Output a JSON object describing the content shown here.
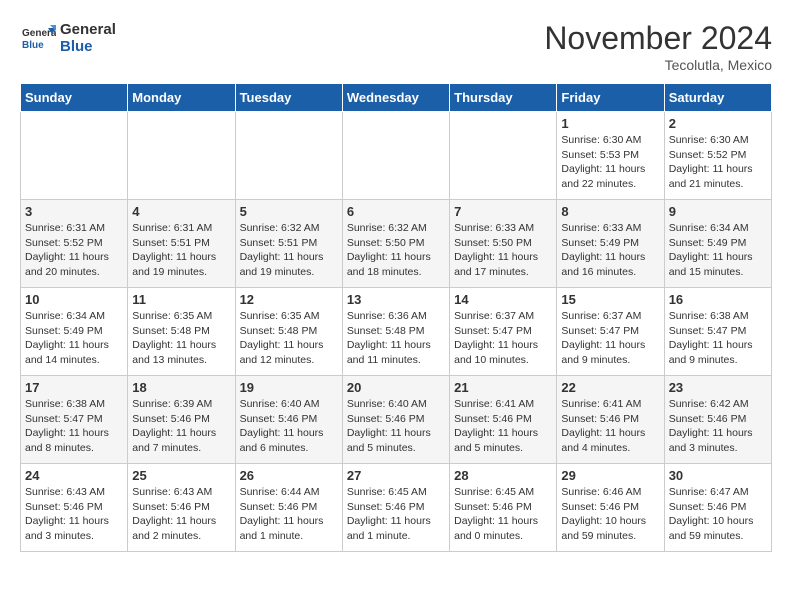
{
  "logo": {
    "line1": "General",
    "line2": "Blue"
  },
  "title": "November 2024",
  "location": "Tecolutla, Mexico",
  "days_of_week": [
    "Sunday",
    "Monday",
    "Tuesday",
    "Wednesday",
    "Thursday",
    "Friday",
    "Saturday"
  ],
  "weeks": [
    [
      {
        "day": "",
        "info": ""
      },
      {
        "day": "",
        "info": ""
      },
      {
        "day": "",
        "info": ""
      },
      {
        "day": "",
        "info": ""
      },
      {
        "day": "",
        "info": ""
      },
      {
        "day": "1",
        "info": "Sunrise: 6:30 AM\nSunset: 5:53 PM\nDaylight: 11 hours\nand 22 minutes."
      },
      {
        "day": "2",
        "info": "Sunrise: 6:30 AM\nSunset: 5:52 PM\nDaylight: 11 hours\nand 21 minutes."
      }
    ],
    [
      {
        "day": "3",
        "info": "Sunrise: 6:31 AM\nSunset: 5:52 PM\nDaylight: 11 hours\nand 20 minutes."
      },
      {
        "day": "4",
        "info": "Sunrise: 6:31 AM\nSunset: 5:51 PM\nDaylight: 11 hours\nand 19 minutes."
      },
      {
        "day": "5",
        "info": "Sunrise: 6:32 AM\nSunset: 5:51 PM\nDaylight: 11 hours\nand 19 minutes."
      },
      {
        "day": "6",
        "info": "Sunrise: 6:32 AM\nSunset: 5:50 PM\nDaylight: 11 hours\nand 18 minutes."
      },
      {
        "day": "7",
        "info": "Sunrise: 6:33 AM\nSunset: 5:50 PM\nDaylight: 11 hours\nand 17 minutes."
      },
      {
        "day": "8",
        "info": "Sunrise: 6:33 AM\nSunset: 5:49 PM\nDaylight: 11 hours\nand 16 minutes."
      },
      {
        "day": "9",
        "info": "Sunrise: 6:34 AM\nSunset: 5:49 PM\nDaylight: 11 hours\nand 15 minutes."
      }
    ],
    [
      {
        "day": "10",
        "info": "Sunrise: 6:34 AM\nSunset: 5:49 PM\nDaylight: 11 hours\nand 14 minutes."
      },
      {
        "day": "11",
        "info": "Sunrise: 6:35 AM\nSunset: 5:48 PM\nDaylight: 11 hours\nand 13 minutes."
      },
      {
        "day": "12",
        "info": "Sunrise: 6:35 AM\nSunset: 5:48 PM\nDaylight: 11 hours\nand 12 minutes."
      },
      {
        "day": "13",
        "info": "Sunrise: 6:36 AM\nSunset: 5:48 PM\nDaylight: 11 hours\nand 11 minutes."
      },
      {
        "day": "14",
        "info": "Sunrise: 6:37 AM\nSunset: 5:47 PM\nDaylight: 11 hours\nand 10 minutes."
      },
      {
        "day": "15",
        "info": "Sunrise: 6:37 AM\nSunset: 5:47 PM\nDaylight: 11 hours\nand 9 minutes."
      },
      {
        "day": "16",
        "info": "Sunrise: 6:38 AM\nSunset: 5:47 PM\nDaylight: 11 hours\nand 9 minutes."
      }
    ],
    [
      {
        "day": "17",
        "info": "Sunrise: 6:38 AM\nSunset: 5:47 PM\nDaylight: 11 hours\nand 8 minutes."
      },
      {
        "day": "18",
        "info": "Sunrise: 6:39 AM\nSunset: 5:46 PM\nDaylight: 11 hours\nand 7 minutes."
      },
      {
        "day": "19",
        "info": "Sunrise: 6:40 AM\nSunset: 5:46 PM\nDaylight: 11 hours\nand 6 minutes."
      },
      {
        "day": "20",
        "info": "Sunrise: 6:40 AM\nSunset: 5:46 PM\nDaylight: 11 hours\nand 5 minutes."
      },
      {
        "day": "21",
        "info": "Sunrise: 6:41 AM\nSunset: 5:46 PM\nDaylight: 11 hours\nand 5 minutes."
      },
      {
        "day": "22",
        "info": "Sunrise: 6:41 AM\nSunset: 5:46 PM\nDaylight: 11 hours\nand 4 minutes."
      },
      {
        "day": "23",
        "info": "Sunrise: 6:42 AM\nSunset: 5:46 PM\nDaylight: 11 hours\nand 3 minutes."
      }
    ],
    [
      {
        "day": "24",
        "info": "Sunrise: 6:43 AM\nSunset: 5:46 PM\nDaylight: 11 hours\nand 3 minutes."
      },
      {
        "day": "25",
        "info": "Sunrise: 6:43 AM\nSunset: 5:46 PM\nDaylight: 11 hours\nand 2 minutes."
      },
      {
        "day": "26",
        "info": "Sunrise: 6:44 AM\nSunset: 5:46 PM\nDaylight: 11 hours\nand 1 minute."
      },
      {
        "day": "27",
        "info": "Sunrise: 6:45 AM\nSunset: 5:46 PM\nDaylight: 11 hours\nand 1 minute."
      },
      {
        "day": "28",
        "info": "Sunrise: 6:45 AM\nSunset: 5:46 PM\nDaylight: 11 hours\nand 0 minutes."
      },
      {
        "day": "29",
        "info": "Sunrise: 6:46 AM\nSunset: 5:46 PM\nDaylight: 10 hours\nand 59 minutes."
      },
      {
        "day": "30",
        "info": "Sunrise: 6:47 AM\nSunset: 5:46 PM\nDaylight: 10 hours\nand 59 minutes."
      }
    ]
  ]
}
